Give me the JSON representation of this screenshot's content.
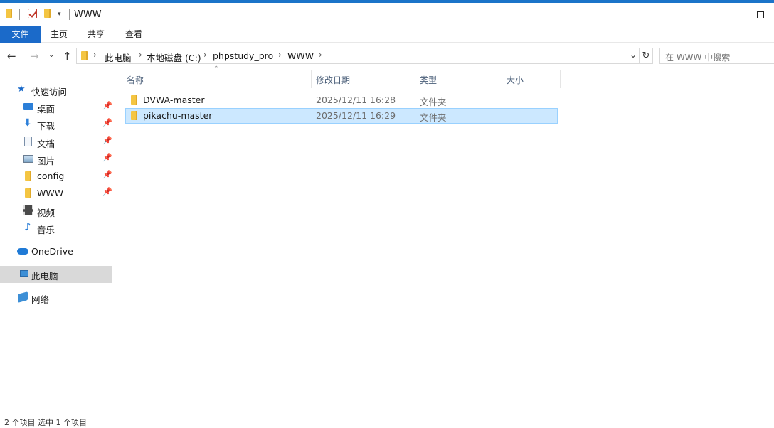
{
  "window": {
    "title": "WWW"
  },
  "ribbon": {
    "tabs": [
      "文件",
      "主页",
      "共享",
      "查看"
    ]
  },
  "address": {
    "crumbs": [
      "此电脑",
      "本地磁盘 (C:)",
      "phpstudy_pro",
      "WWW"
    ],
    "search_placeholder": "在 WWW 中搜索"
  },
  "sidebar": {
    "quick_access": "快速访问",
    "items": [
      {
        "label": "桌面",
        "icon": "desktop-icon",
        "pinned": true
      },
      {
        "label": "下载",
        "icon": "download-icon",
        "pinned": true
      },
      {
        "label": "文档",
        "icon": "document-icon",
        "pinned": true
      },
      {
        "label": "图片",
        "icon": "picture-icon",
        "pinned": true
      },
      {
        "label": "config",
        "icon": "folder-icon",
        "pinned": true
      },
      {
        "label": "WWW",
        "icon": "folder-icon",
        "pinned": true
      },
      {
        "label": "视频",
        "icon": "video-icon",
        "pinned": false
      },
      {
        "label": "音乐",
        "icon": "music-icon",
        "pinned": false
      }
    ],
    "onedrive": "OneDrive",
    "this_pc": "此电脑",
    "network": "网络"
  },
  "columns": [
    "名称",
    "修改日期",
    "类型",
    "大小"
  ],
  "files": [
    {
      "name": "DVWA-master",
      "date": "2025/12/11 16:28",
      "type": "文件夹",
      "size": "",
      "selected": false
    },
    {
      "name": "pikachu-master",
      "date": "2025/12/11 16:29",
      "type": "文件夹",
      "size": "",
      "selected": true
    }
  ],
  "status": "2 个项目    选中 1 个项目",
  "colors": {
    "accent": "#1b6ac9",
    "selection": "#cce8ff",
    "selection_border": "#99d1ff",
    "header_text": "#4c607a"
  }
}
